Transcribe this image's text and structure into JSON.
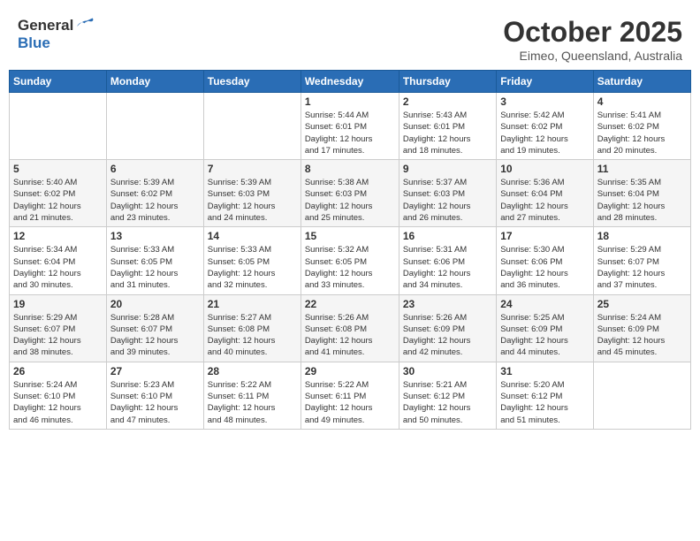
{
  "header": {
    "logo_general": "General",
    "logo_blue": "Blue",
    "month": "October 2025",
    "location": "Eimeo, Queensland, Australia"
  },
  "weekdays": [
    "Sunday",
    "Monday",
    "Tuesday",
    "Wednesday",
    "Thursday",
    "Friday",
    "Saturday"
  ],
  "weeks": [
    [
      {
        "day": "",
        "info": ""
      },
      {
        "day": "",
        "info": ""
      },
      {
        "day": "",
        "info": ""
      },
      {
        "day": "1",
        "info": "Sunrise: 5:44 AM\nSunset: 6:01 PM\nDaylight: 12 hours\nand 17 minutes."
      },
      {
        "day": "2",
        "info": "Sunrise: 5:43 AM\nSunset: 6:01 PM\nDaylight: 12 hours\nand 18 minutes."
      },
      {
        "day": "3",
        "info": "Sunrise: 5:42 AM\nSunset: 6:02 PM\nDaylight: 12 hours\nand 19 minutes."
      },
      {
        "day": "4",
        "info": "Sunrise: 5:41 AM\nSunset: 6:02 PM\nDaylight: 12 hours\nand 20 minutes."
      }
    ],
    [
      {
        "day": "5",
        "info": "Sunrise: 5:40 AM\nSunset: 6:02 PM\nDaylight: 12 hours\nand 21 minutes."
      },
      {
        "day": "6",
        "info": "Sunrise: 5:39 AM\nSunset: 6:02 PM\nDaylight: 12 hours\nand 23 minutes."
      },
      {
        "day": "7",
        "info": "Sunrise: 5:39 AM\nSunset: 6:03 PM\nDaylight: 12 hours\nand 24 minutes."
      },
      {
        "day": "8",
        "info": "Sunrise: 5:38 AM\nSunset: 6:03 PM\nDaylight: 12 hours\nand 25 minutes."
      },
      {
        "day": "9",
        "info": "Sunrise: 5:37 AM\nSunset: 6:03 PM\nDaylight: 12 hours\nand 26 minutes."
      },
      {
        "day": "10",
        "info": "Sunrise: 5:36 AM\nSunset: 6:04 PM\nDaylight: 12 hours\nand 27 minutes."
      },
      {
        "day": "11",
        "info": "Sunrise: 5:35 AM\nSunset: 6:04 PM\nDaylight: 12 hours\nand 28 minutes."
      }
    ],
    [
      {
        "day": "12",
        "info": "Sunrise: 5:34 AM\nSunset: 6:04 PM\nDaylight: 12 hours\nand 30 minutes."
      },
      {
        "day": "13",
        "info": "Sunrise: 5:33 AM\nSunset: 6:05 PM\nDaylight: 12 hours\nand 31 minutes."
      },
      {
        "day": "14",
        "info": "Sunrise: 5:33 AM\nSunset: 6:05 PM\nDaylight: 12 hours\nand 32 minutes."
      },
      {
        "day": "15",
        "info": "Sunrise: 5:32 AM\nSunset: 6:05 PM\nDaylight: 12 hours\nand 33 minutes."
      },
      {
        "day": "16",
        "info": "Sunrise: 5:31 AM\nSunset: 6:06 PM\nDaylight: 12 hours\nand 34 minutes."
      },
      {
        "day": "17",
        "info": "Sunrise: 5:30 AM\nSunset: 6:06 PM\nDaylight: 12 hours\nand 36 minutes."
      },
      {
        "day": "18",
        "info": "Sunrise: 5:29 AM\nSunset: 6:07 PM\nDaylight: 12 hours\nand 37 minutes."
      }
    ],
    [
      {
        "day": "19",
        "info": "Sunrise: 5:29 AM\nSunset: 6:07 PM\nDaylight: 12 hours\nand 38 minutes."
      },
      {
        "day": "20",
        "info": "Sunrise: 5:28 AM\nSunset: 6:07 PM\nDaylight: 12 hours\nand 39 minutes."
      },
      {
        "day": "21",
        "info": "Sunrise: 5:27 AM\nSunset: 6:08 PM\nDaylight: 12 hours\nand 40 minutes."
      },
      {
        "day": "22",
        "info": "Sunrise: 5:26 AM\nSunset: 6:08 PM\nDaylight: 12 hours\nand 41 minutes."
      },
      {
        "day": "23",
        "info": "Sunrise: 5:26 AM\nSunset: 6:09 PM\nDaylight: 12 hours\nand 42 minutes."
      },
      {
        "day": "24",
        "info": "Sunrise: 5:25 AM\nSunset: 6:09 PM\nDaylight: 12 hours\nand 44 minutes."
      },
      {
        "day": "25",
        "info": "Sunrise: 5:24 AM\nSunset: 6:09 PM\nDaylight: 12 hours\nand 45 minutes."
      }
    ],
    [
      {
        "day": "26",
        "info": "Sunrise: 5:24 AM\nSunset: 6:10 PM\nDaylight: 12 hours\nand 46 minutes."
      },
      {
        "day": "27",
        "info": "Sunrise: 5:23 AM\nSunset: 6:10 PM\nDaylight: 12 hours\nand 47 minutes."
      },
      {
        "day": "28",
        "info": "Sunrise: 5:22 AM\nSunset: 6:11 PM\nDaylight: 12 hours\nand 48 minutes."
      },
      {
        "day": "29",
        "info": "Sunrise: 5:22 AM\nSunset: 6:11 PM\nDaylight: 12 hours\nand 49 minutes."
      },
      {
        "day": "30",
        "info": "Sunrise: 5:21 AM\nSunset: 6:12 PM\nDaylight: 12 hours\nand 50 minutes."
      },
      {
        "day": "31",
        "info": "Sunrise: 5:20 AM\nSunset: 6:12 PM\nDaylight: 12 hours\nand 51 minutes."
      },
      {
        "day": "",
        "info": ""
      }
    ]
  ]
}
